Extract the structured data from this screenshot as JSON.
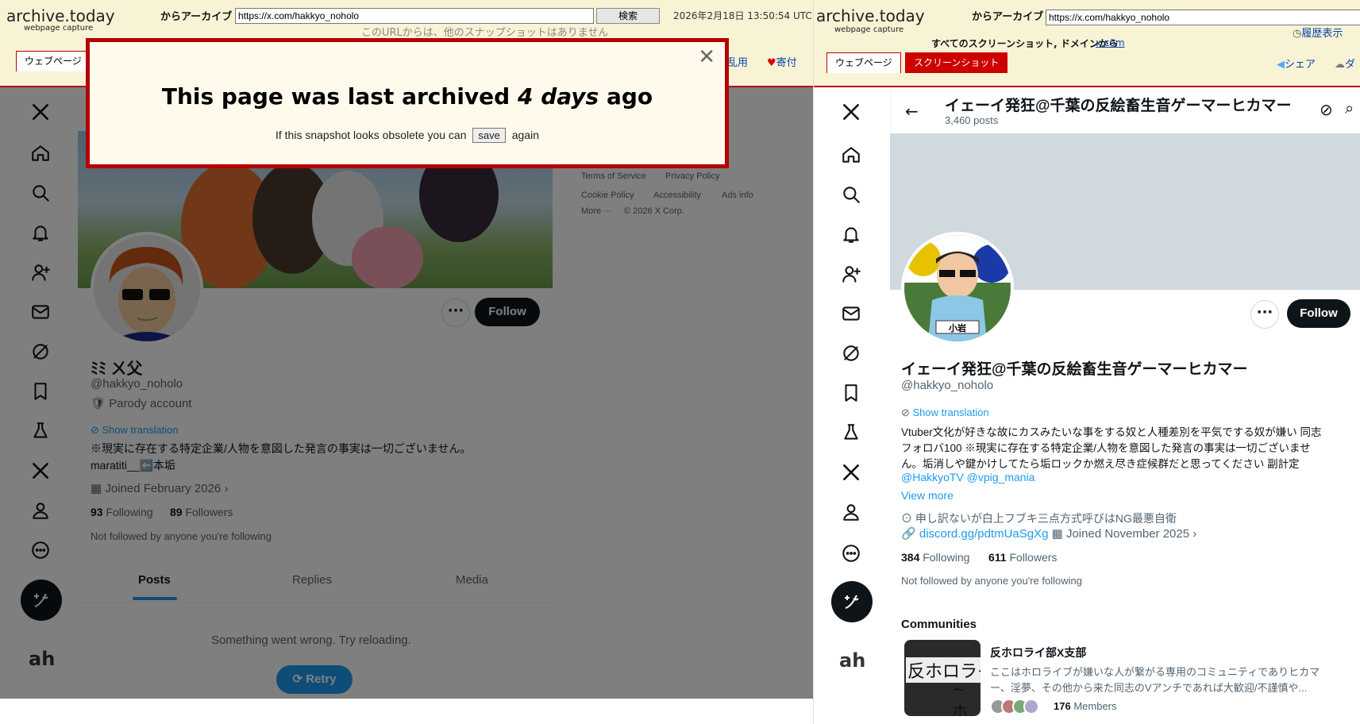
{
  "left": {
    "archive": {
      "logo": "archive.today",
      "logo_sub": "webpage capture",
      "archive_label": "からアーカイブ",
      "url": "https://x.com/hakkyo_noholo",
      "search_btn": "検索",
      "datetime": "2026年2月18日 13:50:54 UTC",
      "no_snapshots": "このURLからは、他のスナップショットはありません",
      "tab_webpage": "ウェブページ",
      "link_report": "乱用",
      "link_donate": "寄付"
    },
    "modal": {
      "title_pre": "This page was last archived",
      "title_em": "4 days",
      "title_post": "ago",
      "sub_pre": "If this snapshot looks obsolete you can",
      "save": "save",
      "sub_post": "again"
    },
    "profile": {
      "name": "ﾐﾐ ㄨ父",
      "handle": "@hakkyo_noholo",
      "parody": "Parody account",
      "show_translation": "Show translation",
      "bio1": "※現実に存在する特定企業/人物を意図した発言の事実は一切ございません。",
      "bio2": "maratiti__⬅️本垢",
      "joined": "Joined February 2026",
      "following_count": "93",
      "following_label": "Following",
      "followers_count": "89",
      "followers_label": "Followers",
      "not_followed": "Not followed by anyone you're following",
      "follow_btn": "Follow",
      "tab_posts": "Posts",
      "tab_replies": "Replies",
      "tab_media": "Media",
      "error": "Something went wrong. Try reloading.",
      "retry": "Retry"
    },
    "footer": {
      "tos": "Terms of Service",
      "privacy": "Privacy Policy",
      "cookie": "Cookie Policy",
      "access": "Accessibility",
      "ads": "Ads info",
      "more": "More ···",
      "copy": "© 2026 X Corp."
    }
  },
  "right": {
    "archive": {
      "logo": "archive.today",
      "logo_sub": "webpage capture",
      "archive_label": "からアーカイブ",
      "url": "https://x.com/hakkyo_noholo",
      "history": "履歴表示",
      "all_screens": "すべてのスクリーンショット, ドメインから",
      "domain_link": "x.com",
      "tab_webpage": "ウェブページ",
      "tab_screenshot": "スクリーンショット",
      "share": "シェア",
      "download": "ダ"
    },
    "header": {
      "name": "イェーイ発狂@千葉の反絵畜生音ゲーマーヒカマー",
      "posts": "3,460 posts"
    },
    "profile": {
      "name": "イェーイ発狂@千葉の反絵畜生音ゲーマーヒカマー",
      "handle": "@hakkyo_noholo",
      "show_translation": "Show translation",
      "bio1": "Vtuber文化が好きな故にカスみたいな事をする奴と人種差別を平気でする奴が嫌い 同志",
      "bio2": "フォロバ100 ※現実に存在する特定企業/人物を意図した発言の事実は一切ございませ",
      "bio3": "ん。垢消しや鍵かけしてたら垢ロックか燃え尽き症候群だと思ってください 副計定",
      "bio4": "@HakkyoTV @vpig_mania",
      "view_more": "View more",
      "location": "申し訳ないが白上フブキ三点方式呼びはNG最悪自衛",
      "link": "discord.gg/pdtmUaSgXg",
      "joined": "Joined November 2025",
      "following_count": "384",
      "following_label": "Following",
      "followers_count": "611",
      "followers_label": "Followers",
      "not_followed": "Not followed by anyone you're following",
      "follow_btn": "Follow",
      "avatar_text": "小岩"
    },
    "communities": {
      "heading": "Communities",
      "name": "反ホロライ部X支部",
      "desc1": "ここはホロライブが嫌いな人が繋がる専用のコミュニティでありヒカマ",
      "desc2": "ー、淫夢、その他から来た同志のVアンチであれば大歓迎/不謹慎や...",
      "thumb1": "反ホロライ",
      "thumb2": "~ホ",
      "members_count": "176",
      "members_label": "Members"
    }
  }
}
